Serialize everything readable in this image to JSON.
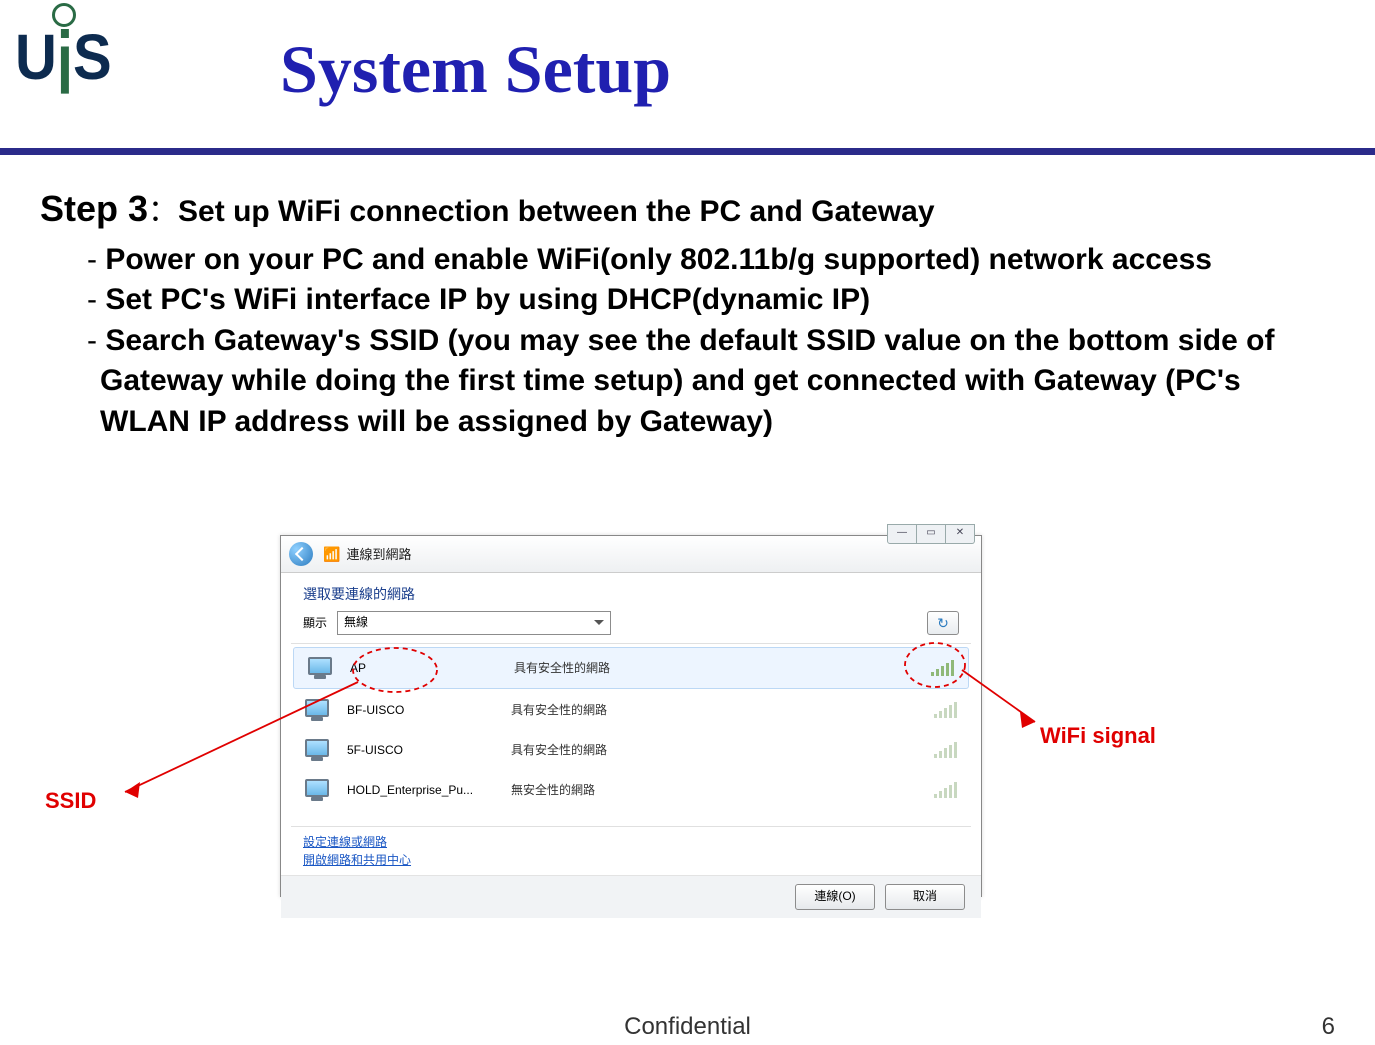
{
  "logo_text": "UiS",
  "title": "System Setup",
  "step_label": "Step 3",
  "step_colon": "：",
  "step_desc": "Set up WiFi connection between the PC and Gateway",
  "bullet1": "Power on your PC and enable WiFi(only 802.11b/g supported) network access",
  "bullet2": "Set PC's WiFi interface IP by using DHCP(dynamic IP)",
  "bullet3": "Search Gateway's SSID (you may see the default SSID value on the bottom side of Gateway while doing the first time setup) and get connected with Gateway (PC's WLAN IP address will be assigned by Gateway)",
  "window": {
    "title": "連線到網路",
    "select_label": "選取要連線的網路",
    "filter_label": "顯示",
    "filter_value": "無線",
    "networks": [
      {
        "ssid": "AP",
        "security": "具有安全性的網路",
        "strength": "full"
      },
      {
        "ssid": "BF-UISCO",
        "security": "具有安全性的網路",
        "strength": "dim"
      },
      {
        "ssid": "5F-UISCO",
        "security": "具有安全性的網路",
        "strength": "dim"
      },
      {
        "ssid": "HOLD_Enterprise_Pu...",
        "security": "無安全性的網路",
        "strength": "dim"
      }
    ],
    "link1": "設定連線或網路",
    "link2": "開啟網路和共用中心",
    "btn_connect": "連線(O)",
    "btn_cancel": "取消"
  },
  "anno_ssid": "SSID",
  "anno_signal": "WiFi signal",
  "footer_center": "Confidential",
  "footer_page": "6"
}
